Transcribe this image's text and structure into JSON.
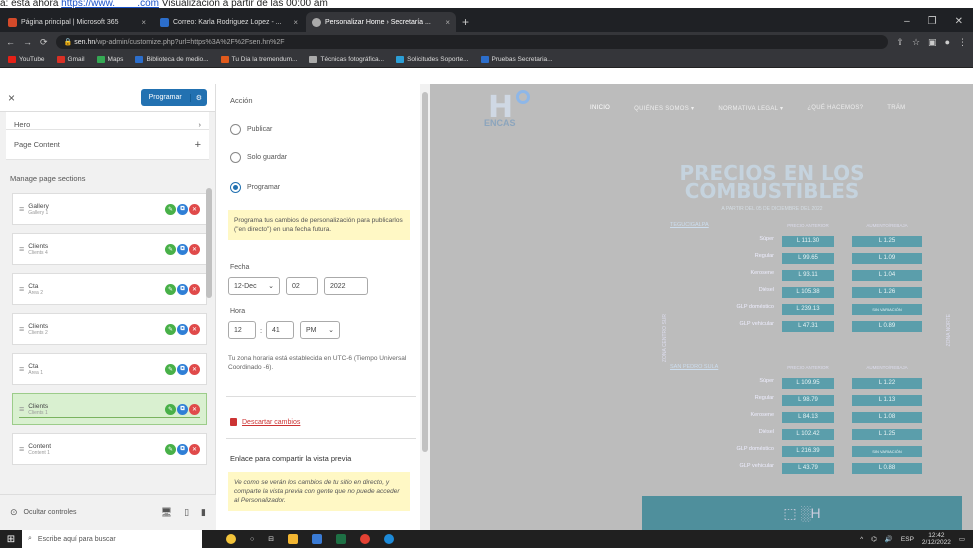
{
  "caption": {
    "prefix": "a: esta ahora",
    "link": "https://www.____.com",
    "suffix": "Visualizacion a partir de las 00:00 am"
  },
  "browser": {
    "tabs": [
      {
        "title": "Página principal | Microsoft 365",
        "color": "#d34a2a"
      },
      {
        "title": "Correo: Karla Rodriguez Lopez - ...",
        "color": "#2c6ecb"
      },
      {
        "title": "Personalizar Home › Secretaría ...",
        "color": "#555"
      }
    ],
    "url_host": "sen.hn",
    "url_path": "/wp-admin/customize.php?url=https%3A%2F%2Fsen.hn%2F",
    "bookmarks": [
      {
        "label": "YouTube",
        "color": "#e62117"
      },
      {
        "label": "Gmail",
        "color": "#d93025"
      },
      {
        "label": "Maps",
        "color": "#34a853"
      },
      {
        "label": "Biblioteca de medio...",
        "color": "#2c6ecb"
      },
      {
        "label": "Tu Dia la tremendum...",
        "color": "#e05a1c"
      },
      {
        "label": "Técnicas fotográfica...",
        "color": "#aaa"
      },
      {
        "label": "Solicitudes Soporte...",
        "color": "#2c9fd6"
      },
      {
        "label": "Pruebas Secretaria...",
        "color": "#2c6ecb"
      }
    ]
  },
  "panel1": {
    "close": "×",
    "program_label": "Programar",
    "gear": "⚙",
    "items": [
      {
        "label": "Hero",
        "arrow": "›"
      },
      {
        "label": "Page Content",
        "arrow": "+"
      }
    ],
    "sections_title": "Manage page sections",
    "sections": [
      {
        "name": "Gallery",
        "sub": "Gallery 1"
      },
      {
        "name": "Clients",
        "sub": "Clients 4"
      },
      {
        "name": "Cta",
        "sub": "Area 2"
      },
      {
        "name": "Clients",
        "sub": "Clients 2"
      },
      {
        "name": "Cta",
        "sub": "Area 1"
      },
      {
        "name": "Clients",
        "sub": "Clients 1"
      },
      {
        "name": "Content",
        "sub": "Content 1"
      }
    ],
    "footer_label": "Ocultar controles"
  },
  "panel2": {
    "action_label": "Acción",
    "options": [
      "Publicar",
      "Solo guardar",
      "Programar"
    ],
    "note": "Programa tus cambios de personalización para publicarlos (\"en directo\") en una fecha futura.",
    "date_label": "Fecha",
    "month": "12-Dec",
    "day": "02",
    "year": "2022",
    "time_label": "Hora",
    "hour": "12",
    "minute": "41",
    "ampm": "PM",
    "tz_note": "Tu zona horaria está establecida en UTC-6 (Tiempo Universal Coordinado -6).",
    "discard": "Descartar cambios",
    "share_title": "Enlace para compartir la vista previa",
    "share_note": "Ve como se verán los cambios de tu sitio en directo, y comparte la vista previa con gente que no puede acceder al Personalizador."
  },
  "site": {
    "nav": [
      "INICIO",
      "QUIÉNES SOMOS ▾",
      "NORMATIVA LEGAL ▾",
      "¿QUÉ HACEMOS?",
      "TRÁM"
    ],
    "logo_text": "ENCAS",
    "title": "PRECIOS EN LOS COMBUSTIBLES",
    "subtitle": "A PARTIR DEL 05 DE DICIEMBRE DEL 2022",
    "col1": "PRECIO ANTERIOR",
    "col2": "AUMENTO/REBAJA",
    "side_left": "ZONA CENTRO SUR",
    "side_right": "ZONA NORTE",
    "groups": [
      {
        "title": "TEGUCIGALPA",
        "rows": [
          {
            "name": "Súper",
            "v1": "L 111.30",
            "v2": "L 1.25"
          },
          {
            "name": "Regular",
            "v1": "L 99.65",
            "v2": "L 1.09"
          },
          {
            "name": "Kerosene",
            "v1": "L 93.11",
            "v2": "L 1.04"
          },
          {
            "name": "Diésel",
            "v1": "L 105.38",
            "v2": "L 1.26"
          },
          {
            "name": "GLP doméstico",
            "v1": "L 239.13",
            "v2": "SIN VARIACIÓN"
          },
          {
            "name": "GLP vehicular",
            "v1": "L 47.31",
            "v2": "L 0.89"
          }
        ]
      },
      {
        "title": "SAN PEDRO SULA",
        "rows": [
          {
            "name": "Súper",
            "v1": "L 109.95",
            "v2": "L 1.22"
          },
          {
            "name": "Regular",
            "v1": "L 98.79",
            "v2": "L 1.13"
          },
          {
            "name": "Kerosene",
            "v1": "L 84.13",
            "v2": "L 1.08"
          },
          {
            "name": "Diésel",
            "v1": "L 102.42",
            "v2": "L 1.25"
          },
          {
            "name": "GLP doméstico",
            "v1": "L 216.39",
            "v2": "SIN VARIACIÓN"
          },
          {
            "name": "GLP vehicular",
            "v1": "L 43.79",
            "v2": "L 0.88"
          }
        ]
      }
    ]
  },
  "taskbar": {
    "search": "Escribe aquí para buscar",
    "lang": "ESP",
    "time": "12:42",
    "date": "2/12/2022"
  }
}
